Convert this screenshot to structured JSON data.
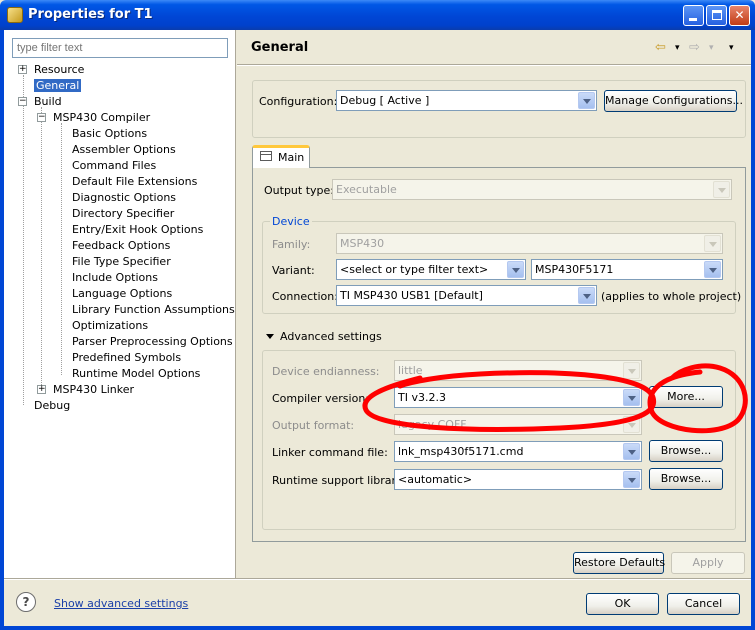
{
  "window": {
    "title": "Properties for T1"
  },
  "filter": {
    "placeholder": "type filter text"
  },
  "tree": {
    "resource": "Resource",
    "general": "General",
    "build": "Build",
    "msp430_compiler": "MSP430 Compiler",
    "compiler_children": [
      "Basic Options",
      "Assembler Options",
      "Command Files",
      "Default File Extensions",
      "Diagnostic Options",
      "Directory Specifier",
      "Entry/Exit Hook Options",
      "Feedback Options",
      "File Type Specifier",
      "Include Options",
      "Language Options",
      "Library Function Assumptions",
      "Optimizations",
      "Parser Preprocessing Options",
      "Predefined Symbols",
      "Runtime Model Options"
    ],
    "msp430_linker": "MSP430 Linker",
    "debug": "Debug"
  },
  "page": {
    "title": "General"
  },
  "configuration": {
    "label": "Configuration:",
    "value": "Debug  [ Active ]",
    "manage_button": "Manage Configurations..."
  },
  "tab": {
    "label": "Main"
  },
  "output_type": {
    "label": "Output type:",
    "value": "Executable"
  },
  "device": {
    "legend": "Device",
    "family_label": "Family:",
    "family_value": "MSP430",
    "variant_label": "Variant:",
    "variant_filter": "<select or type filter text>",
    "variant_value": "MSP430F5171",
    "connection_label": "Connection:",
    "connection_value": "TI MSP430 USB1 [Default]",
    "connection_note": "(applies to whole project)"
  },
  "advanced": {
    "header": "Advanced settings",
    "endianness_label": "Device endianness:",
    "endianness_value": "little",
    "compiler_label": "Compiler version:",
    "compiler_value": "TI v3.2.3",
    "more_button": "More...",
    "output_format_label": "Output format:",
    "output_format_value": "legacy COFF",
    "linker_cmd_label": "Linker command file:",
    "linker_cmd_value": "lnk_msp430f5171.cmd",
    "browse_button": "Browse...",
    "runtime_label": "Runtime support library:",
    "runtime_value": "<automatic>"
  },
  "buttons": {
    "restore_defaults": "Restore Defaults",
    "apply": "Apply",
    "ok": "OK",
    "cancel": "Cancel"
  },
  "footer": {
    "help_glyph": "?",
    "show_advanced": "Show advanced settings"
  },
  "colors": {
    "annotation": "#ff0000",
    "selection": "#316ac5",
    "titlebar": "#0046d5"
  }
}
